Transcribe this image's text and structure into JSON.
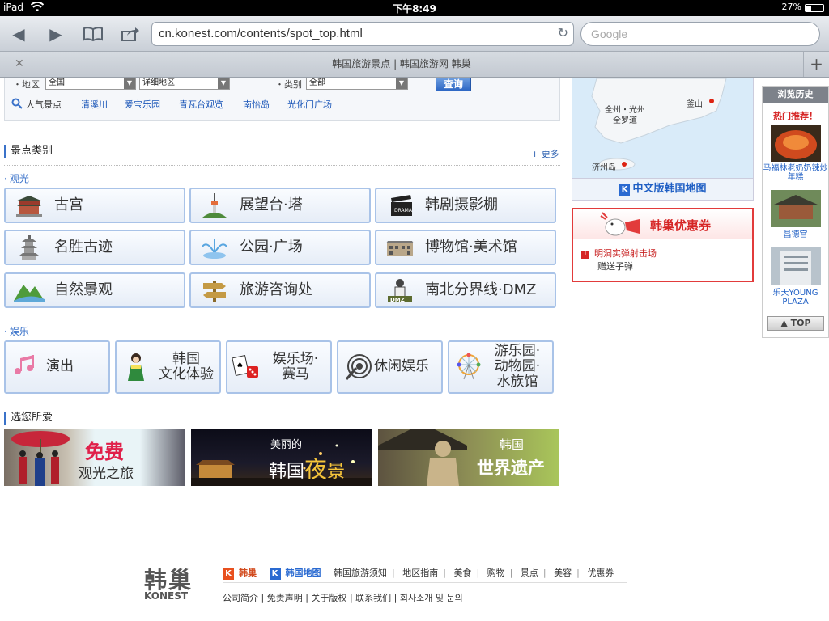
{
  "status": {
    "carrier": "iPad",
    "time": "下午8:49",
    "battery": "27%"
  },
  "browser": {
    "url": "cn.konest.com/contents/spot_top.html",
    "search_placeholder": "Google",
    "tab_title": "韩国旅游景点 | 韩国旅游网 韩巢"
  },
  "search_form": {
    "region_label": "・地区",
    "region_value": "全国",
    "detail_value": "详细地区",
    "category_label": "・类别",
    "category_value": "全部",
    "submit_label": "查询",
    "hot_label": "人气景点",
    "hot_links": [
      "清溪川",
      "爱宝乐园",
      "青瓦台观览",
      "南怡岛",
      "光化门广场"
    ]
  },
  "categories": {
    "title": "景点类别",
    "more": "+ 更多",
    "sightseeing_label": "观光",
    "sightseeing": [
      "古宫",
      "展望台·塔",
      "韩剧摄影棚",
      "名胜古迹",
      "公园·广场",
      "博物馆·美术馆",
      "自然景观",
      "旅游咨询处",
      "南北分界线·DMZ"
    ],
    "entertainment_label": "娱乐",
    "entertainment": [
      {
        "l1": "演出",
        "l2": "",
        "l3": ""
      },
      {
        "l1": "韩国",
        "l2": "文化体验",
        "l3": ""
      },
      {
        "l1": "娱乐场·",
        "l2": "赛马",
        "l3": ""
      },
      {
        "l1": "休闲娱乐",
        "l2": "",
        "l3": ""
      },
      {
        "l1": "游乐园·",
        "l2": "动物园·",
        "l3": "水族馆"
      }
    ]
  },
  "picks": {
    "title": "选您所爱",
    "banners": [
      {
        "big": "免费",
        "small": "观光之旅"
      },
      {
        "small": "美丽的",
        "big1": "韩国",
        "big2": "夜",
        "big3": "景"
      },
      {
        "small": "韩国",
        "big": "世界遗产"
      }
    ]
  },
  "map": {
    "labels": [
      "全州・光州",
      "全罗道",
      "釜山",
      "济州岛"
    ],
    "link": "中文版韩国地图"
  },
  "coupon": {
    "title": "韩巢优惠券",
    "item_title": "明洞实弹射击场",
    "item_desc": "赠送子弹"
  },
  "history": {
    "title": "浏览历史",
    "hot": "热门推荐！",
    "items": [
      "马福林老奶奶辣炒年糕",
      "昌德宫",
      "乐天YOUNG PLAZA"
    ],
    "top": "▲ TOP"
  },
  "footer": {
    "logo": "韩巢",
    "logo_en": "KONEST",
    "brand1": "韩巢",
    "brand2": "韩国地图",
    "links": [
      "韩国旅游须知",
      "地区指南",
      "美食",
      "购物",
      "景点",
      "美容",
      "优惠券"
    ],
    "links2": [
      "公司简介",
      "免责声明",
      "关于版权",
      "联系我们",
      "회사소개 및 문의"
    ]
  },
  "colors": {
    "accent": "#3a72c9",
    "coupon_red": "#e23b3b",
    "link": "#1a56b8"
  }
}
